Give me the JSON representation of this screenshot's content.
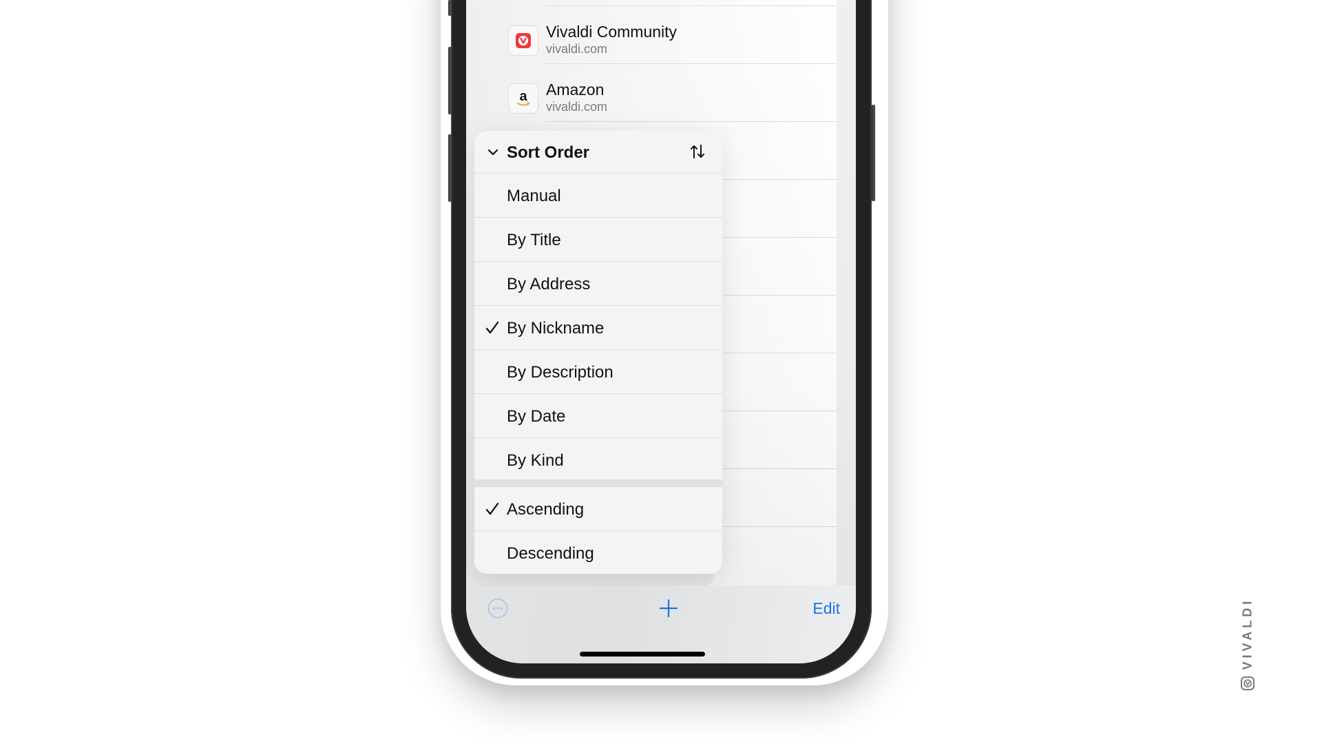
{
  "bookmarks": [
    {
      "title": "Vivaldi Community",
      "url": "vivaldi.com",
      "icon": "vivaldi-logo-icon"
    },
    {
      "title": "Amazon",
      "url": "vivaldi.com",
      "icon": "amazon-logo-icon"
    }
  ],
  "sort_menu": {
    "title": "Sort Order",
    "collapse_icon": "chevron-down-icon",
    "header_icon": "sort-arrows-icon",
    "options": [
      {
        "label": "Manual",
        "checked": false
      },
      {
        "label": "By Title",
        "checked": false
      },
      {
        "label": "By Address",
        "checked": false
      },
      {
        "label": "By Nickname",
        "checked": true
      },
      {
        "label": "By Description",
        "checked": false
      },
      {
        "label": "By Date",
        "checked": false
      },
      {
        "label": "By Kind",
        "checked": false
      }
    ],
    "direction_options": [
      {
        "label": "Ascending",
        "checked": true
      },
      {
        "label": "Descending",
        "checked": false
      }
    ]
  },
  "toolbar": {
    "more_icon": "ellipsis-circle-icon",
    "add_icon": "plus-icon",
    "edit_label": "Edit"
  },
  "watermark": {
    "text": "VIVALDI",
    "logo_icon": "vivaldi-logo-icon"
  },
  "colors": {
    "accent": "#1a73e8",
    "vivaldi_red": "#ef3939",
    "amazon_orange": "#f3a33b"
  }
}
